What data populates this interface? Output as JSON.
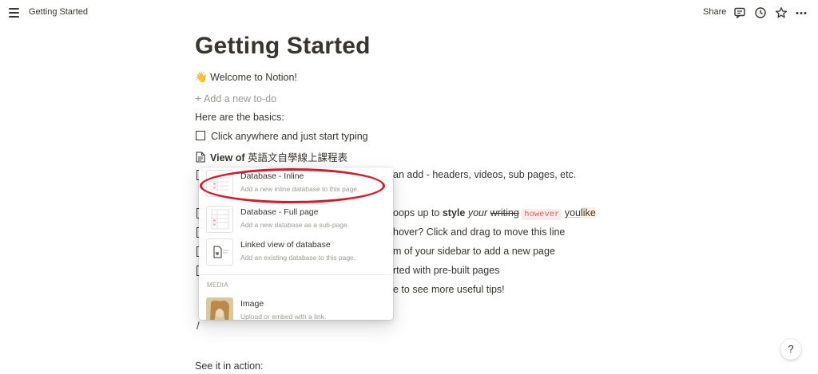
{
  "topbar": {
    "breadcrumb": "Getting Started",
    "share_label": "Share"
  },
  "page": {
    "title": "Getting Started",
    "welcome_emoji": "👋",
    "welcome_text": "Welcome to Notion!",
    "add_todo_plus": "+",
    "add_todo_text": "Add a new to-do",
    "basics_heading": "Here are the basics:",
    "line_click": "Click anywhere and just start typing",
    "view_bold": "View of",
    "view_text": "英語文自學線上課程表",
    "line_add_partial": "an add - headers, videos, sub pages, etc.",
    "line_style": {
      "pre": "oops up to ",
      "bold": "style",
      "italic": "your",
      "strike": "writing",
      "code": "however",
      "underline": "you",
      "highlight": "like"
    },
    "line_hover": "hover? Click and drag to move this line",
    "line_sidebar": "m of your sidebar to add a new page",
    "line_started": "rted with pre-built pages",
    "line_tips": "e to see more useful tips!",
    "slash": "/",
    "see_it": "See it in action:"
  },
  "menu": {
    "items": [
      {
        "title": "Database - Inline",
        "desc": "Add a new inline database to this page."
      },
      {
        "title": "Database - Full page",
        "desc": "Add a new database as a sub-page."
      },
      {
        "title": "Linked view of database",
        "desc": "Add an existing database to this page."
      }
    ],
    "section_media": "MEDIA",
    "image_item": {
      "title": "Image",
      "desc": "Upload or embed with a link."
    }
  },
  "help_label": "?",
  "colors": {
    "text": "#37352f",
    "muted": "#9b9a97",
    "annotation_red": "#d7192b",
    "code_red": "#eb5757"
  },
  "icons": [
    "hamburger-menu-icon",
    "comment-icon",
    "clock-icon",
    "star-icon",
    "more-icon",
    "checkbox-icon",
    "page-icon",
    "table-icon",
    "linked-db-icon"
  ]
}
